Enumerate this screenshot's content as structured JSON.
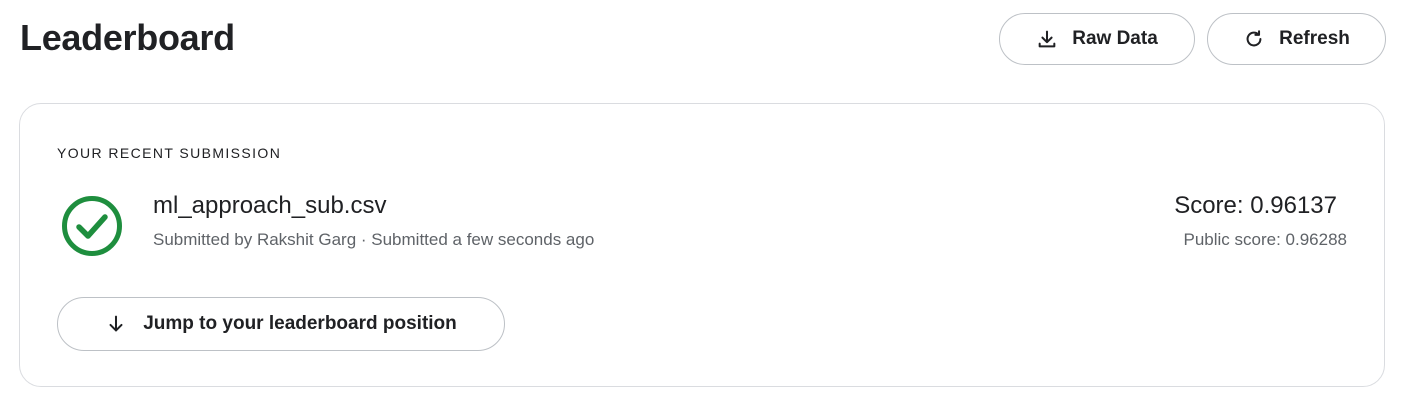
{
  "header": {
    "title": "Leaderboard",
    "raw_data_label": "Raw Data",
    "refresh_label": "Refresh"
  },
  "submission": {
    "section_label": "YOUR RECENT SUBMISSION",
    "status_icon": "check-circle-icon",
    "file_name": "ml_approach_sub.csv",
    "meta": "Submitted by Rakshit Garg · Submitted a few seconds ago",
    "score": "Score: 0.96137",
    "public_score": "Public score: 0.96288",
    "jump_label": "Jump to your leaderboard position"
  },
  "colors": {
    "success": "#1e8e3e",
    "border": "#dadce0",
    "text": "#202124",
    "muted": "#5f6368"
  }
}
